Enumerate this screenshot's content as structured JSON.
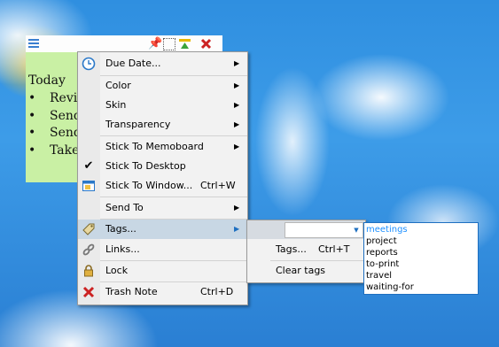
{
  "note": {
    "heading": "Today",
    "items": [
      "Revi",
      "Send",
      "Send",
      "Take"
    ],
    "toolbar_icons": [
      "menu-icon",
      "pin-icon",
      "select-icon",
      "roll-icon",
      "close-icon"
    ]
  },
  "menu": {
    "items": [
      {
        "label": "Due Date...",
        "icon": "clock-icon",
        "submenu": true
      },
      {
        "label": "Color",
        "submenu": true
      },
      {
        "label": "Skin",
        "submenu": true
      },
      {
        "label": "Transparency",
        "submenu": true
      },
      {
        "label": "Stick To Memoboard",
        "submenu": true
      },
      {
        "label": "Stick To Desktop",
        "icon": "check-icon",
        "checked": true
      },
      {
        "label": "Stick To Window...",
        "shortcut": "Ctrl+W",
        "icon": "window-icon"
      },
      {
        "label": "Send To",
        "submenu": true
      },
      {
        "label": "Tags...",
        "icon": "tag-icon",
        "submenu": true,
        "highlighted": true
      },
      {
        "label": "Links...",
        "icon": "link-icon"
      },
      {
        "label": "Lock",
        "icon": "lock-icon"
      },
      {
        "label": "Trash Note",
        "shortcut": "Ctrl+D",
        "icon": "trash-icon"
      }
    ]
  },
  "tags_submenu": {
    "combo_value": "",
    "items": [
      {
        "label": "Tags...",
        "shortcut": "Ctrl+T"
      },
      {
        "label": "Clear tags"
      }
    ]
  },
  "tag_list": {
    "items": [
      "meetings",
      "project",
      "reports",
      "to-print",
      "travel",
      "waiting-for"
    ],
    "selected": "meetings"
  },
  "colors": {
    "note_body": "#c9f0a4",
    "menu_highlight": "#c8d7e4",
    "accent": "#1e6fc0"
  }
}
